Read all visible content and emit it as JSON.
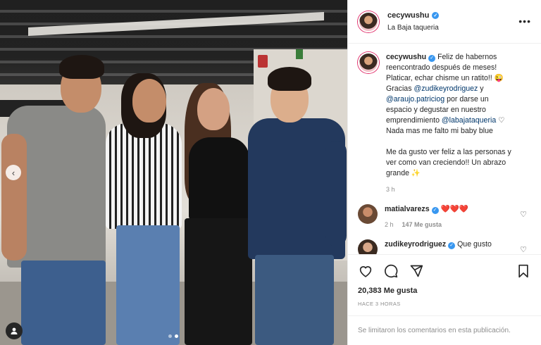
{
  "post": {
    "username": "cecywushu",
    "location": "La Baja taqueria",
    "more_label": "•••"
  },
  "caption": {
    "username": "cecywushu",
    "text_1": " Feliz de habernos reencontrado después de meses! Platicar, echar chisme un ratito!! 😜 Gracias ",
    "mention_1": "@zudikeyrodriguez",
    "text_2": " y ",
    "mention_2": "@araujo.patriciog",
    "text_3": " por darse un espacio y degustar en nuestro emprendimiento ",
    "mention_3": "@labajataqueria",
    "text_4": " ♡ Nada mas me falto mi baby blue",
    "text_5": "Me da gusto ver feliz a las personas y ver como van creciendo!! Un abrazo grande ✨",
    "time": "3 h"
  },
  "comments": [
    {
      "username": "matialvarezs",
      "text": " ❤️❤️❤️",
      "time": "2 h",
      "likes": "147 Me gusta"
    },
    {
      "username": "zudikeyrodriguez",
      "text": " Que gusto"
    }
  ],
  "likes_count": "20,383 Me gusta",
  "posted_ago": "HACE 3 HORAS",
  "comments_limited": "Se limitaron los comentarios en esta publicación.",
  "colors": {
    "verified": "#3897f0",
    "mention": "#00376b",
    "muted": "#8e8e8e"
  },
  "icons": [
    "heart-icon",
    "comment-icon",
    "share-icon",
    "bookmark-icon",
    "verified-icon",
    "chevron-left-icon",
    "user-tag-icon",
    "more-icon"
  ]
}
